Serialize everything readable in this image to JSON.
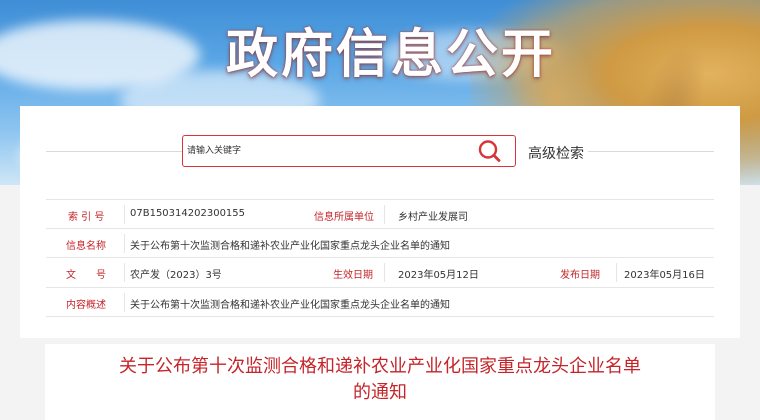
{
  "banner": {
    "title": "政府信息公开"
  },
  "search": {
    "placeholder": "请输入关键字",
    "button_icon": "search-icon",
    "advanced_label": "高级检索"
  },
  "info": {
    "index_label": "索 引 号",
    "index_value": "07B150314202300155",
    "org_label": "信息所属单位",
    "org_value": "乡村产业发展司",
    "name_label": "信息名称",
    "name_value": "关于公布第十次监测合格和递补农业产业化国家重点龙头企业名单的通知",
    "doc_label": "文　　号",
    "doc_value": "农产发（2023）3号",
    "effective_label": "生效日期",
    "effective_value": "2023年05月12日",
    "publish_label": "发布日期",
    "publish_value": "2023年05月16日",
    "summary_label": "内容概述",
    "summary_value": "关于公布第十次监测合格和递补农业产业化国家重点龙头企业名单的通知"
  },
  "article": {
    "title_line1": "关于公布第十次监测合格和递补农业产业化国家重点龙头企业名单",
    "title_line2": "的通知"
  },
  "colors": {
    "accent": "#c4252a",
    "banner_sky": "#4a97dc",
    "background": "#f3f3f3"
  }
}
